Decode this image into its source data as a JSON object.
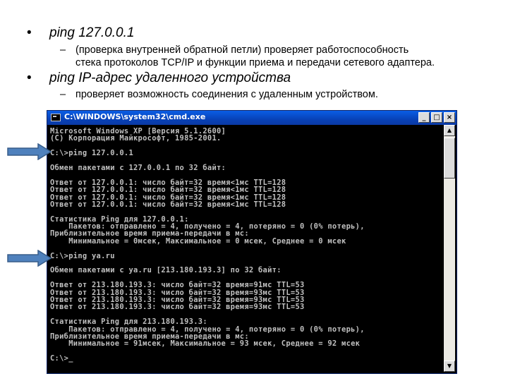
{
  "bullets": [
    {
      "bullet": "•",
      "text": "ping 127.0.0.1",
      "sub": {
        "dash": "–",
        "lines": [
          "(проверка внутренней обратной петли) проверяет работоспособность",
          "стека протоколов TCP/IP и функции приема и передачи сетевого адаптера."
        ]
      }
    },
    {
      "bullet": "•",
      "text": "ping IP-адрес удаленного устройства",
      "sub": {
        "dash": "–",
        "lines": [
          "проверяет возможность соединения с удаленным устройством."
        ]
      }
    }
  ],
  "window": {
    "title": "C:\\WINDOWS\\system32\\cmd.exe",
    "buttons": {
      "minimize": "_",
      "maximize": "□",
      "close": "×"
    },
    "scrollbar": {
      "up": "▲",
      "down": "▼"
    }
  },
  "console_lines": [
    "Microsoft Windows XP [Версия 5.1.2600]",
    "(С) Корпорация Майкрософт, 1985-2001.",
    "",
    "C:\\>ping 127.0.0.1",
    "",
    "Обмен пакетами с 127.0.0.1 по 32 байт:",
    "",
    "Ответ от 127.0.0.1: число байт=32 время<1мс TTL=128",
    "Ответ от 127.0.0.1: число байт=32 время<1мс TTL=128",
    "Ответ от 127.0.0.1: число байт=32 время<1мс TTL=128",
    "Ответ от 127.0.0.1: число байт=32 время<1мс TTL=128",
    "",
    "Статистика Ping для 127.0.0.1:",
    "    Пакетов: отправлено = 4, получено = 4, потеряно = 0 (0% потерь),",
    "Приблизительное время приема-передачи в мс:",
    "    Минимальное = 0мсек, Максимальное = 0 мсек, Среднее = 0 мсек",
    "",
    "C:\\>ping ya.ru",
    "",
    "Обмен пакетами с ya.ru [213.180.193.3] по 32 байт:",
    "",
    "Ответ от 213.180.193.3: число байт=32 время=91мс TTL=53",
    "Ответ от 213.180.193.3: число байт=32 время=93мс TTL=53",
    "Ответ от 213.180.193.3: число байт=32 время=93мс TTL=53",
    "Ответ от 213.180.193.3: число байт=32 время=93мс TTL=53",
    "",
    "Статистика Ping для 213.180.193.3:",
    "    Пакетов: отправлено = 4, получено = 4, потеряно = 0 (0% потерь),",
    "Приблизительное время приема-передачи в мс:",
    "    Минимальное = 91мсек, Максимальное = 93 мсек, Среднее = 92 мсек",
    "",
    "C:\\>_"
  ],
  "arrows": {
    "color": "#4f81bd",
    "stroke": "#385d8a"
  }
}
